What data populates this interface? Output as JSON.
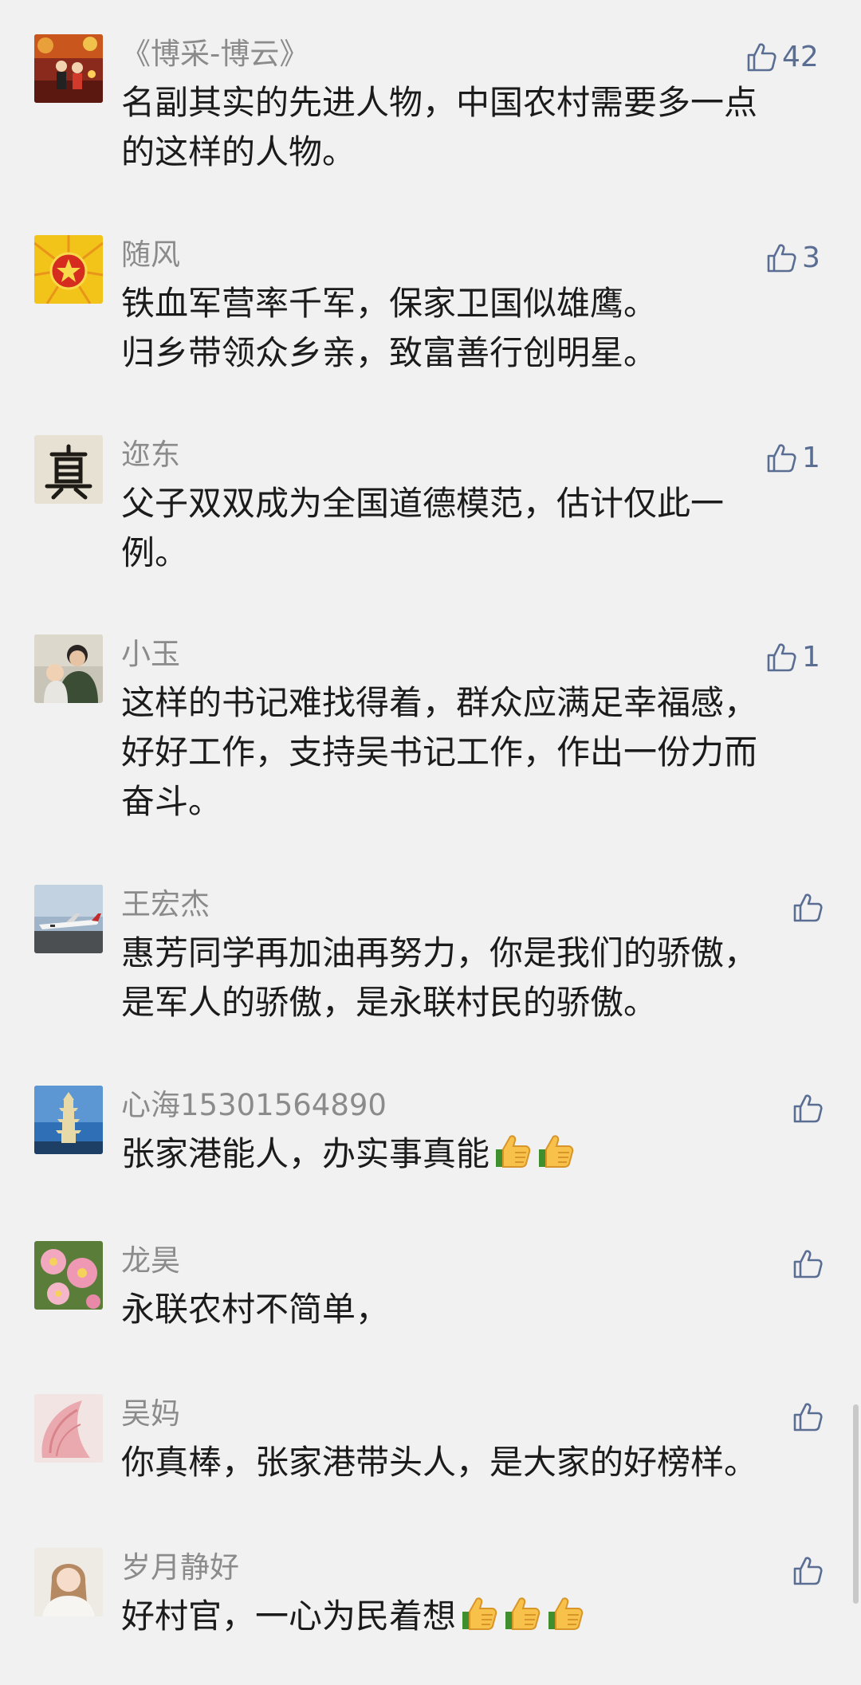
{
  "comments": [
    {
      "author": "《博采-博云》",
      "text": "名副其实的先进人物，中国农村需要多一点\n的这样的人物。",
      "likes": "42",
      "avatar_icon": "stage-performance-photo"
    },
    {
      "author": "随风",
      "text": "铁血军营率千军，保家卫国似雄鹰。\n归乡带领众乡亲，致富善行创明星。",
      "likes": "3",
      "avatar_icon": "red-star-emblem"
    },
    {
      "author": "迩东",
      "text": "父子双双成为全国道德模范，估计仅此一\n例。",
      "likes": "1",
      "avatar_icon": "calligraphy-character"
    },
    {
      "author": "小玉",
      "text": "这样的书记难找得着，群众应满足幸福感，\n好好工作，支持吴书记工作，作出一份力而\n奋斗。",
      "likes": "1",
      "avatar_icon": "woman-with-baby-photo"
    },
    {
      "author": "王宏杰",
      "text": "惠芳同学再加油再努力，你是我们的骄傲，\n是军人的骄傲，是永联村民的骄傲。",
      "likes": "",
      "avatar_icon": "airplane-photo"
    },
    {
      "author": "心海15301564890",
      "text": "张家港能人，办实事真能",
      "likes": "",
      "avatar_icon": "pagoda-photo",
      "emoji": [
        "thumbs-up-emoji",
        "thumbs-up-emoji"
      ]
    },
    {
      "author": "龙昊",
      "text": "永联农村不简单，",
      "likes": "",
      "avatar_icon": "pink-flowers-photo"
    },
    {
      "author": "吴妈",
      "text": "你真棒，张家港带头人，是大家的好榜样。",
      "likes": "",
      "avatar_icon": "pink-petal-photo"
    },
    {
      "author": "岁月静好",
      "text": "好村官，一心为民着想",
      "likes": "",
      "avatar_icon": "girl-portrait-photo",
      "emoji": [
        "thumbs-up-emoji",
        "thumbs-up-emoji",
        "thumbs-up-emoji"
      ]
    }
  ],
  "colors": {
    "background": "#f1f1f1",
    "author": "#8b8b8b",
    "text": "#1b1b1b",
    "like": "#5a6e93"
  }
}
